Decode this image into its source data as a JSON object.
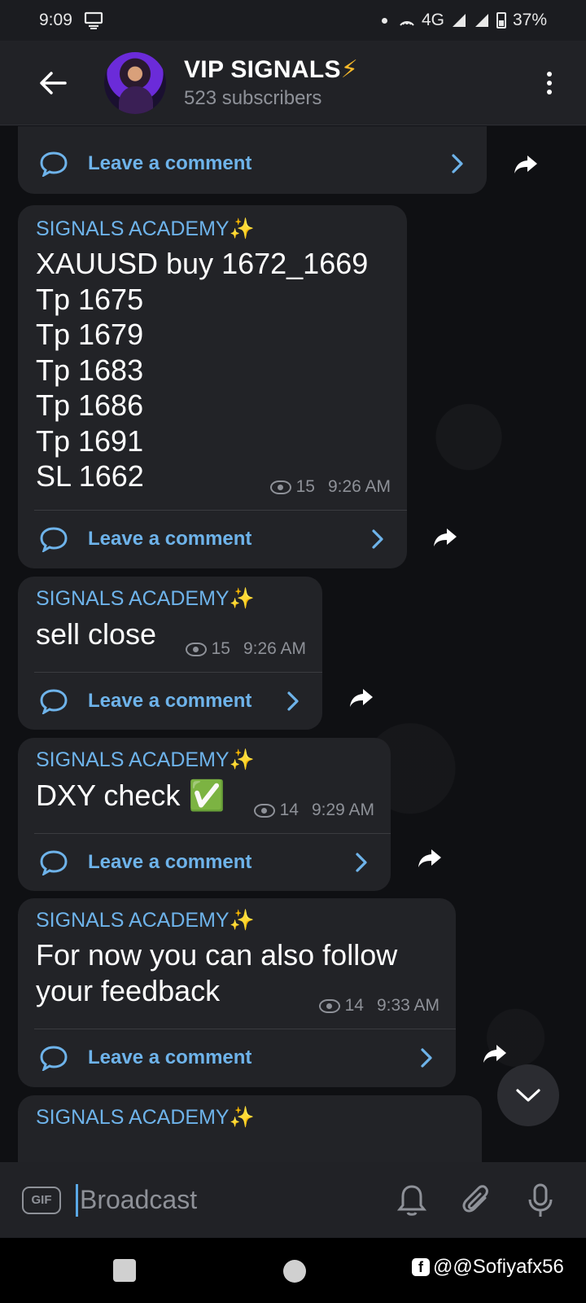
{
  "status_bar": {
    "time": "9:09",
    "network": "4G",
    "battery": "37%"
  },
  "header": {
    "title": "VIP SIGNALS",
    "title_emoji": "⚡",
    "subtitle": "523 subscribers"
  },
  "messages": [
    {
      "sender": "SIGNALS ACADEMY",
      "text": "XAUUSD buy 1672_1669\nTp 1675\nTp 1679\nTp 1683\nTp 1686\nTp 1691\nSL 1662",
      "views": "15",
      "time": "9:26 AM",
      "comment_label": "Leave a comment"
    },
    {
      "sender": "SIGNALS ACADEMY",
      "text": "sell close",
      "views": "15",
      "time": "9:26 AM",
      "comment_label": "Leave a comment"
    },
    {
      "sender": "SIGNALS ACADEMY",
      "text": "DXY check",
      "text_emoji": "✅",
      "views": "14",
      "time": "9:29 AM",
      "comment_label": "Leave a comment"
    },
    {
      "sender": "SIGNALS ACADEMY",
      "text": "For now you can also follow\nyour feedback",
      "views": "14",
      "time": "9:33 AM",
      "comment_label": "Leave a comment"
    },
    {
      "sender": "SIGNALS ACADEMY"
    }
  ],
  "top_partial": {
    "comment_label": "Leave a comment"
  },
  "sender_emoji": "✨",
  "input": {
    "gif_label": "GIF",
    "placeholder": "Broadcast"
  },
  "watermark": {
    "fb_glyph": "f",
    "text": "@@Sofiyafx56"
  },
  "colors": {
    "accent": "#6eb3ea",
    "bubble": "#222327",
    "background": "#0f1013",
    "bar": "#212226"
  }
}
